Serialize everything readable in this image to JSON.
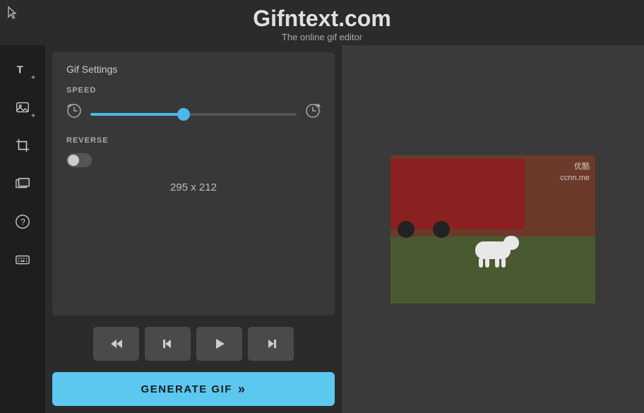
{
  "header": {
    "title": "Gifntext.com",
    "subtitle": "The online gif editor"
  },
  "sidebar": {
    "items": [
      {
        "id": "add-text",
        "icon": "T+",
        "label": "Add Text"
      },
      {
        "id": "add-image",
        "icon": "IMG+",
        "label": "Add Image"
      },
      {
        "id": "crop",
        "icon": "CROP",
        "label": "Crop"
      },
      {
        "id": "frames",
        "icon": "FRAMES",
        "label": "Frames"
      },
      {
        "id": "help",
        "icon": "?",
        "label": "Help"
      },
      {
        "id": "keyboard",
        "icon": "KB",
        "label": "Keyboard"
      }
    ]
  },
  "gif_settings": {
    "title": "Gif Settings",
    "speed_label": "SPEED",
    "speed_value": 45,
    "reverse_label": "REVERSE",
    "reverse_enabled": false,
    "dimensions": "295 x 212"
  },
  "playback": {
    "rewind_label": "⏪",
    "prev_label": "⏮",
    "play_label": "▶",
    "next_label": "⏭"
  },
  "generate_btn": {
    "label": "GENERATE GIF",
    "chevrons": "»"
  },
  "preview": {
    "watermark_line1": "优酷",
    "watermark_line2": "ccnn.me"
  }
}
